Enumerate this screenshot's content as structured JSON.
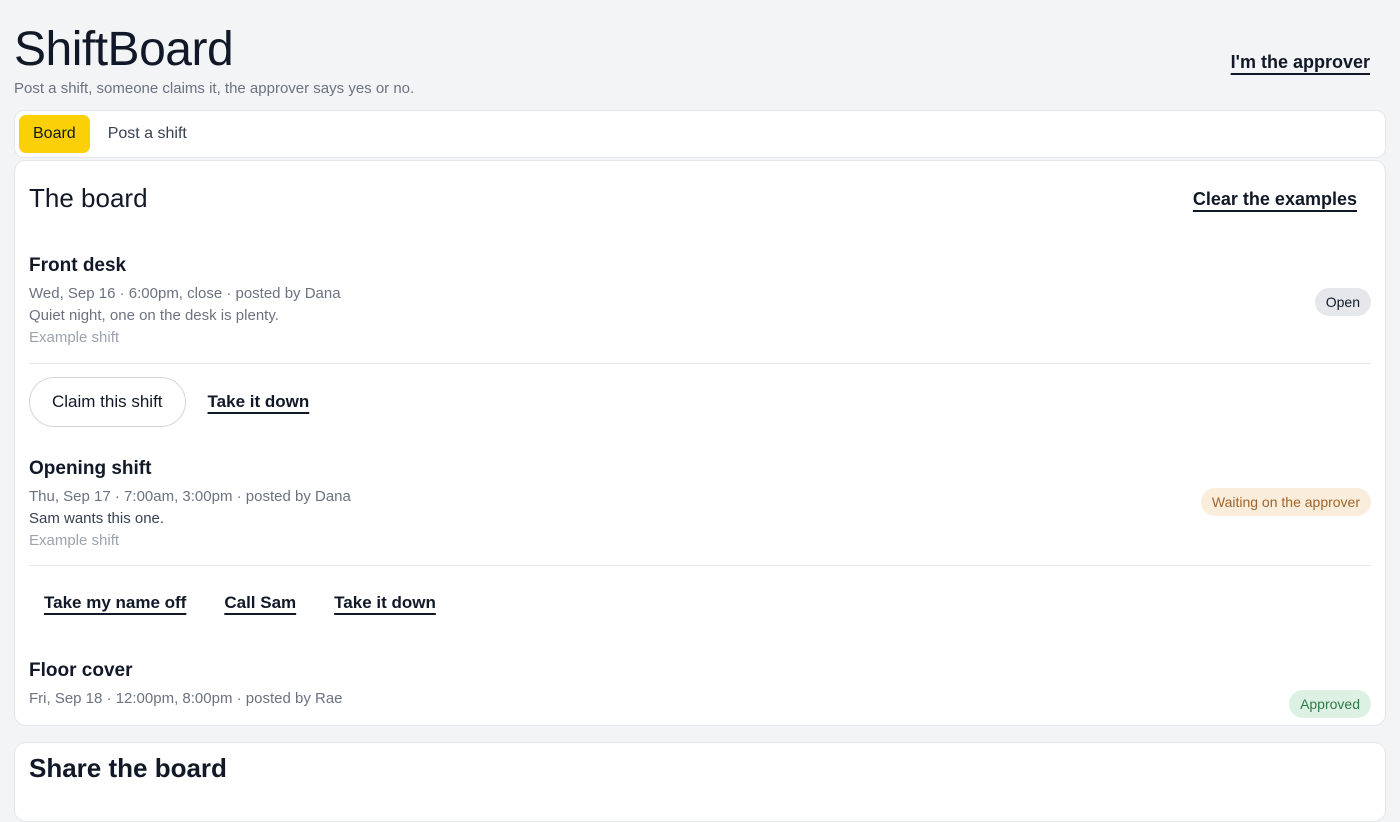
{
  "app": {
    "title": "ShiftBoard",
    "subtitle": "Post a shift, someone claims it, the approver says yes or no.",
    "approver_link": "I'm the approver"
  },
  "tabs": [
    {
      "label": "Board",
      "active": true
    },
    {
      "label": "Post a shift",
      "active": false
    }
  ],
  "board": {
    "title": "The board",
    "clear_label": "Clear the examples",
    "shifts": [
      {
        "title": "Front desk",
        "meta": "Wed, Sep 16 · 6:00pm, close · posted by Dana",
        "note": "Quiet night, one on the desk is plenty.",
        "tag": "Example shift",
        "status": "Open",
        "actions": [
          "Claim this shift",
          "Take it down"
        ]
      },
      {
        "title": "Opening shift",
        "meta": "Thu, Sep 17 · 7:00am, 3:00pm · posted by Dana",
        "note": "Sam wants this one.",
        "tag": "Example shift",
        "status": "Waiting on the approver",
        "actions": [
          "Take my name off",
          "Call Sam",
          "Take it down"
        ]
      },
      {
        "title": "Floor cover",
        "meta": "Fri, Sep 18 · 12:00pm, 8:00pm · posted by Rae",
        "status": "Approved"
      }
    ]
  },
  "share": {
    "title": "Share the board"
  },
  "colors": {
    "accent": "#fcd007",
    "open_badge": "#e5e7eb",
    "waiting_badge": "#fbeddc",
    "approved_badge": "#dcf1e3"
  }
}
